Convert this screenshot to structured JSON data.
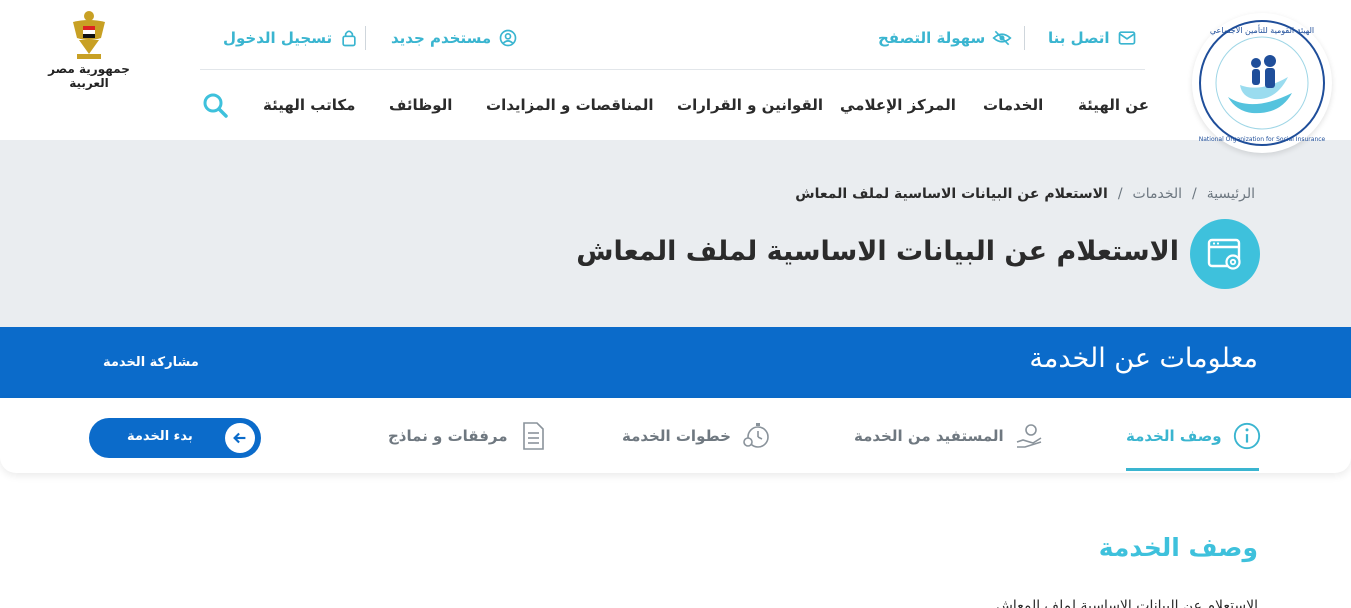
{
  "header": {
    "utility_links": {
      "contact": "اتصل بنا",
      "accessibility": "سهولة التصفح",
      "new_user": "مستخدم جديد",
      "login": "تسجيل الدخول"
    },
    "nav": [
      "عن الهيئة",
      "الخدمات",
      "المركز الإعلامي",
      "القوانين و القرارات",
      "المناقصات و المزايدات",
      "الوظائف",
      "مكاتب الهيئة"
    ],
    "emblem_text": "جمهورية مصر العربية",
    "logo_arabic": "الهيئة القومية للتأمين الاجتماعي",
    "logo_english": "National Organization for Social Insurance"
  },
  "breadcrumb": {
    "home": "الرئيسية",
    "separator": "/",
    "services": "الخدمات",
    "current": "الاستعلام عن البيانات الاساسية لملف المعاش"
  },
  "page_title": "الاستعلام عن البيانات الاساسية لملف المعاش",
  "service_bar": {
    "title": "معلومات عن الخدمة",
    "share": "مشاركة الخدمة"
  },
  "tabs": {
    "description": "وصف الخدمة",
    "beneficiary": "المستفيد من الخدمة",
    "steps": "خطوات الخدمة",
    "attachments": "مرفقات و نماذج"
  },
  "start_button": "بدء الخدمة",
  "section_title": "وصف الخدمة",
  "section_body_peek": "الاستعلام عن البيانات الاساسية لملف المعاش",
  "colors": {
    "accent_cyan": "#3ec1dc",
    "brand_blue": "#0b6bca",
    "band_gray": "#eaedf0"
  }
}
